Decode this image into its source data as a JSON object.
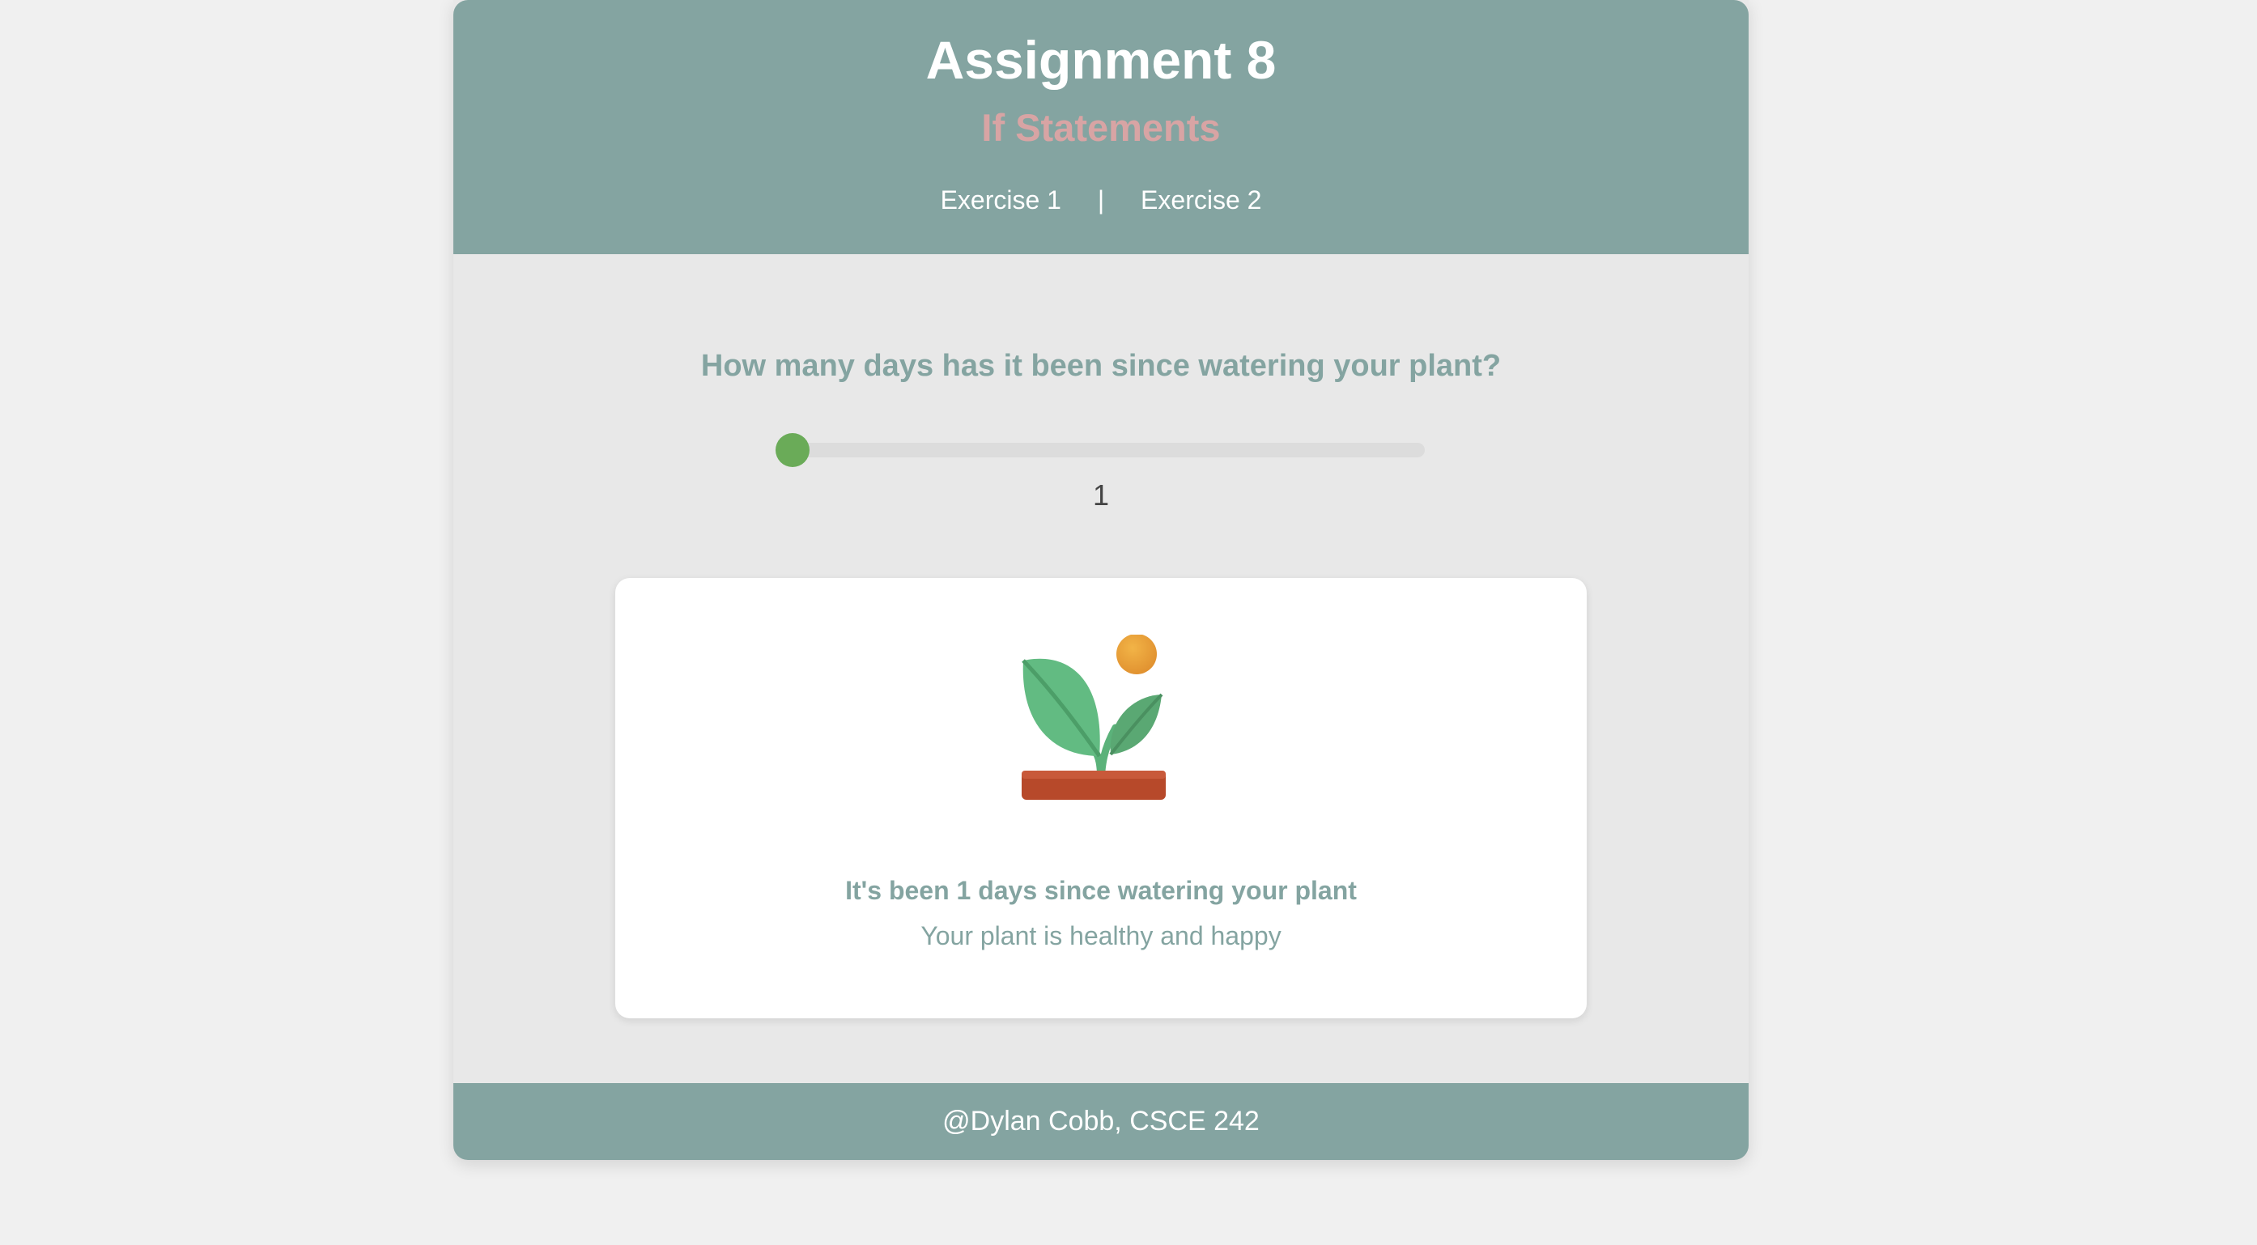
{
  "header": {
    "title": "Assignment 8",
    "subtitle": "If Statements",
    "nav": {
      "exercise1": "Exercise 1",
      "separator": "|",
      "exercise2": "Exercise 2"
    }
  },
  "main": {
    "question": "How many days has it been since watering your plant?",
    "slider": {
      "value": "1",
      "fraction": 0
    },
    "card": {
      "icon": "seedling-icon",
      "status": "It's been 1 days since watering your plant",
      "message": "Your plant is healthy and happy"
    }
  },
  "footer": {
    "text": "@Dylan Cobb, CSCE 242"
  },
  "colors": {
    "primary": "#84a4a1",
    "subtitle": "#d8a4a4",
    "slider_thumb": "#6aab58",
    "page_bg": "#f0f0f0",
    "content_bg": "#e8e8e8"
  }
}
